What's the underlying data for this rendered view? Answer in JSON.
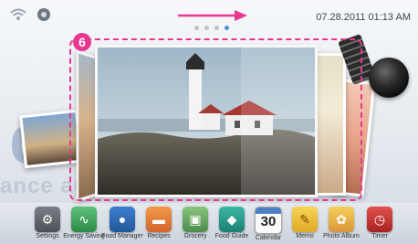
{
  "status_bar": {
    "clock": "07.28.2011 01:13 AM"
  },
  "highlight": {
    "step_number": "6"
  },
  "pager": {
    "pages": 4,
    "active_index": 3
  },
  "dock": {
    "apps": [
      {
        "label": "Settings",
        "icon": "settings-gear-icon"
      },
      {
        "label": "Energy Saving",
        "icon": "energy-wave-icon"
      },
      {
        "label": "Food Manager",
        "icon": "food-manager-icon"
      },
      {
        "label": "Recipes",
        "icon": "recipes-pot-icon"
      },
      {
        "label": "Grocery",
        "icon": "grocery-basket-icon"
      },
      {
        "label": "Food Guide",
        "icon": "food-guide-icon"
      },
      {
        "label": "Calendar",
        "icon": "calendar-icon",
        "icon_text": "30"
      },
      {
        "label": "Memo",
        "icon": "memo-icon"
      },
      {
        "label": "Photo Album",
        "icon": "photo-album-flower-icon"
      },
      {
        "label": "Timer",
        "icon": "timer-clock-icon"
      }
    ]
  },
  "colors": {
    "highlight": "#e8378f",
    "pager_active": "#4a8fd6"
  }
}
